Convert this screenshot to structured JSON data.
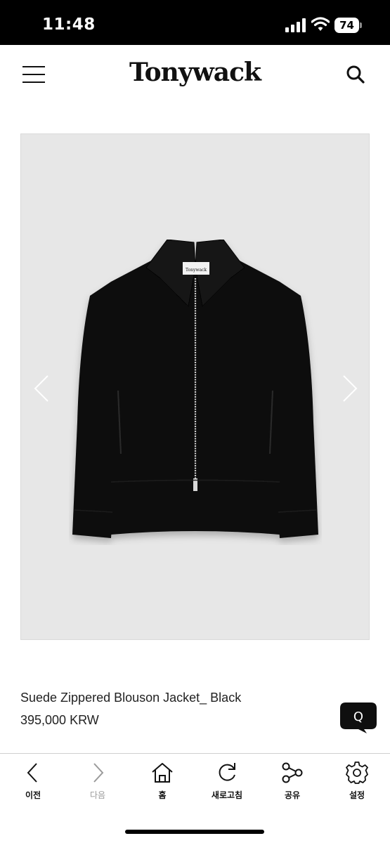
{
  "status_bar": {
    "time": "11:48",
    "battery_level": "74",
    "icons": [
      "cellular-signal-icon",
      "wifi-icon",
      "battery-icon"
    ]
  },
  "header": {
    "brand": "Tonywack",
    "icons": [
      "hamburger-menu-icon",
      "search-icon"
    ]
  },
  "gallery": {
    "image_alt": "black-suede-zip-jacket",
    "icons": [
      "chevron-left-icon",
      "chevron-right-icon"
    ]
  },
  "product": {
    "name": "Suede Zippered Blouson Jacket_ Black",
    "price": "395,000 KRW"
  },
  "chat": {
    "icon": "q-chat-icon",
    "label": "Q"
  },
  "toolbar": {
    "items": [
      {
        "label": "이전",
        "icon": "back-arrow-icon",
        "enabled": true
      },
      {
        "label": "다음",
        "icon": "forward-arrow-icon",
        "enabled": false
      },
      {
        "label": "홈",
        "icon": "home-icon",
        "enabled": true
      },
      {
        "label": "새로고침",
        "icon": "refresh-icon",
        "enabled": true
      },
      {
        "label": "공유",
        "icon": "share-icon",
        "enabled": true
      },
      {
        "label": "설정",
        "icon": "gear-icon",
        "enabled": true
      }
    ]
  },
  "colors": {
    "status_bar_bg": "#000000",
    "gallery_bg": "#e7e7e7",
    "text": "#222222",
    "disabled_text": "#9a9a9a"
  }
}
